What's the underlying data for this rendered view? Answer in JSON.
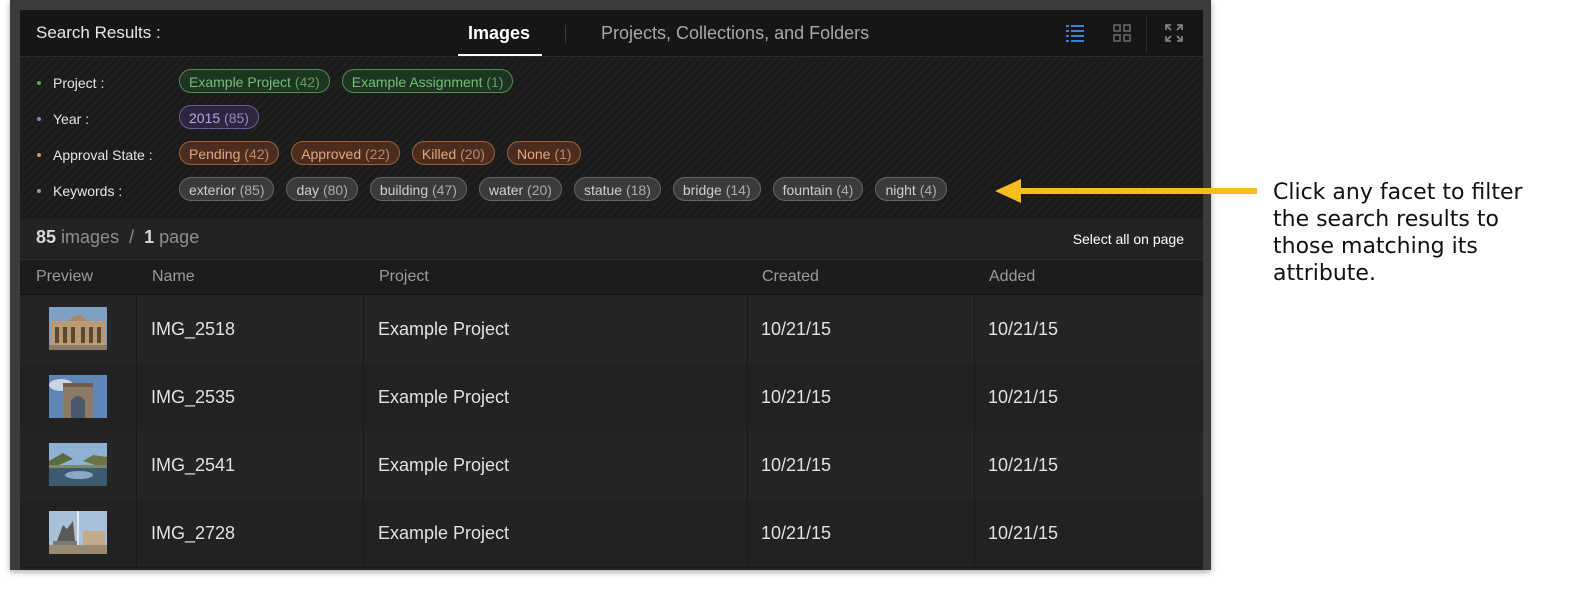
{
  "header": {
    "title": "Search Results :",
    "tabs": [
      {
        "label": "Images",
        "active": true
      },
      {
        "label": "Projects, Collections, and Folders",
        "active": false
      }
    ],
    "view_buttons": [
      "list-view-icon",
      "grid-view-icon",
      "fullscreen-icon"
    ]
  },
  "facets": [
    {
      "label": "Project :",
      "color": "#4caf50",
      "chips": [
        {
          "name": "Example Project",
          "count": "(42)"
        },
        {
          "name": "Example Assignment",
          "count": "(1)"
        }
      ]
    },
    {
      "label": "Year :",
      "color": "#8e7cc3",
      "chips": [
        {
          "name": "2015",
          "count": "(85)"
        }
      ]
    },
    {
      "label": "Approval State :",
      "color": "#e0915e",
      "chips": [
        {
          "name": "Pending",
          "count": "(42)"
        },
        {
          "name": "Approved",
          "count": "(22)"
        },
        {
          "name": "Killed",
          "count": "(20)"
        },
        {
          "name": "None",
          "count": "(1)"
        }
      ]
    },
    {
      "label": "Keywords :",
      "color": "#9a9a9a",
      "chips": [
        {
          "name": "exterior",
          "count": "(85)"
        },
        {
          "name": "day",
          "count": "(80)"
        },
        {
          "name": "building",
          "count": "(47)"
        },
        {
          "name": "water",
          "count": "(20)"
        },
        {
          "name": "statue",
          "count": "(18)"
        },
        {
          "name": "bridge",
          "count": "(14)"
        },
        {
          "name": "fountain",
          "count": "(4)"
        },
        {
          "name": "night",
          "count": "(4)"
        }
      ]
    }
  ],
  "summary": {
    "image_count": "85",
    "images_word": "images",
    "separator": "/",
    "page_count": "1",
    "page_word": "page",
    "select_all": "Select all on page"
  },
  "table": {
    "columns": [
      "Preview",
      "Name",
      "Project",
      "Created",
      "Added"
    ],
    "rows": [
      {
        "name": "IMG_2518",
        "project": "Example Project",
        "created": "10/21/15",
        "added": "10/21/15",
        "thumb": "building"
      },
      {
        "name": "IMG_2535",
        "project": "Example Project",
        "created": "10/21/15",
        "added": "10/21/15",
        "thumb": "arch"
      },
      {
        "name": "IMG_2541",
        "project": "Example Project",
        "created": "10/21/15",
        "added": "10/21/15",
        "thumb": "water"
      },
      {
        "name": "IMG_2728",
        "project": "Example Project",
        "created": "10/21/15",
        "added": "10/21/15",
        "thumb": "statue"
      }
    ]
  },
  "annotation": {
    "text": "Click any facet to filter the search results to those matching its attribute.",
    "arrow_color": "#f5bd1f"
  }
}
